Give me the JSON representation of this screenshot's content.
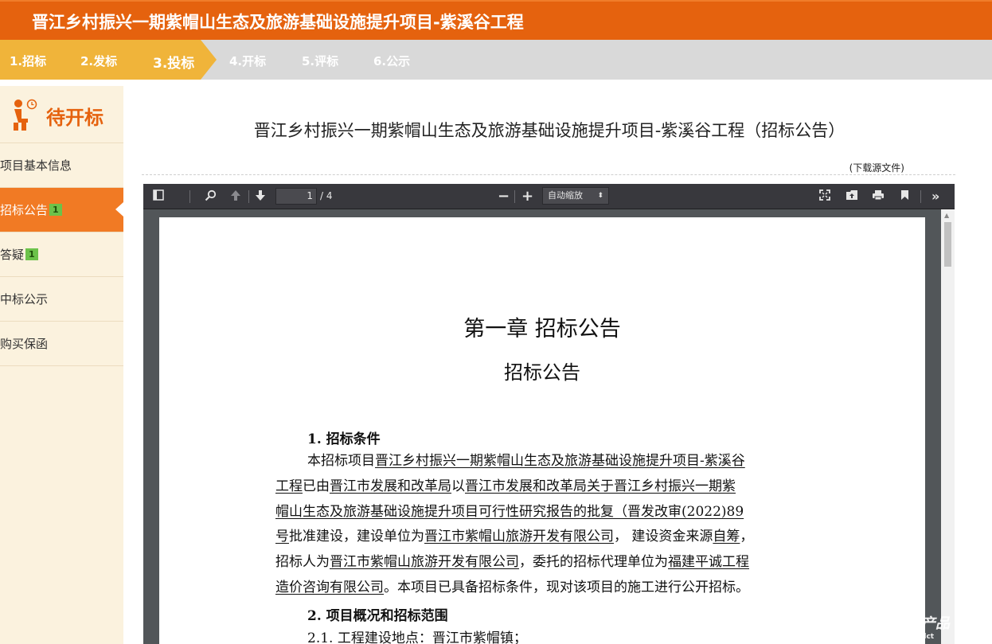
{
  "header": {
    "title": "晋江乡村振兴一期紫帽山生态及旅游基础设施提升项目-紫溪谷工程"
  },
  "steps": [
    {
      "label": "1.招标"
    },
    {
      "label": "2.发标"
    },
    {
      "label": "3.投标"
    },
    {
      "label": "4.开标"
    },
    {
      "label": "5.评标"
    },
    {
      "label": "6.公示"
    }
  ],
  "sidebar": {
    "status": "待开标",
    "items": [
      {
        "label": "项目基本信息",
        "badge": ""
      },
      {
        "label": "招标公告",
        "badge": "1"
      },
      {
        "label": "答疑",
        "badge": "1"
      },
      {
        "label": "中标公示",
        "badge": ""
      },
      {
        "label": "购买保函",
        "badge": ""
      }
    ]
  },
  "main": {
    "title": "晋江乡村振兴一期紫帽山生态及旅游基础设施提升项目-紫溪谷工程（招标公告）",
    "download_label": "(下载源文件)"
  },
  "viewer": {
    "page_current": "1",
    "page_total": "/ 4",
    "zoom_label": "自动缩放",
    "zoom_caret": "⬍"
  },
  "document": {
    "chapter": "第一章  招标公告",
    "subtitle": "招标公告",
    "sec1_heading": "1. 招标条件",
    "l1_a": "本招标项目",
    "l1_b": "晋江乡村振兴一期紫帽山生态及旅游基础设施提升项目-紫溪谷",
    "l2_a": "工程",
    "l2_b": "已由",
    "l2_c": "晋江市发展和改革局",
    "l2_d": "以",
    "l2_e": "晋江市发展和改革局关于晋江乡村振兴一期紫",
    "l3_a": "帽山生态及旅游基础设施提升项目可行性研究报告的批复（晋发改审(2022)89",
    "l4_a": "号",
    "l4_b": "批准建设，建设单位为",
    "l4_c": "晋江市紫帽山旅游开发有限公司",
    "l4_d": "， 建设资金来源",
    "l4_e": "自筹",
    "l4_f": "，",
    "l5_a": "招标人为",
    "l5_b": "晋江市紫帽山旅游开发有限公司",
    "l5_c": "，委托的招标代理单位为",
    "l5_d": "福建平诚工程",
    "l6_a": "造价咨询有限公司",
    "l6_b": "。本项目已具备招标条件，现对该项目的施工进行公开招标。",
    "sec2_heading": "2. 项目概况和招标范围",
    "l8": "2.1.  工程建设地点：晋江市紫帽镇；"
  },
  "watermark": {
    "text": "产品",
    "sub": "dct"
  },
  "colors": {
    "header_bg": "#e5620e",
    "steps_done": "#f0b43a",
    "steps_todo": "#d9d9d9",
    "sidebar_bg": "#fbf2de",
    "sidebar_active": "#f17a24",
    "badge": "#6cc24a",
    "viewer_bg": "#525659",
    "toolbar_bg": "#38383d"
  }
}
